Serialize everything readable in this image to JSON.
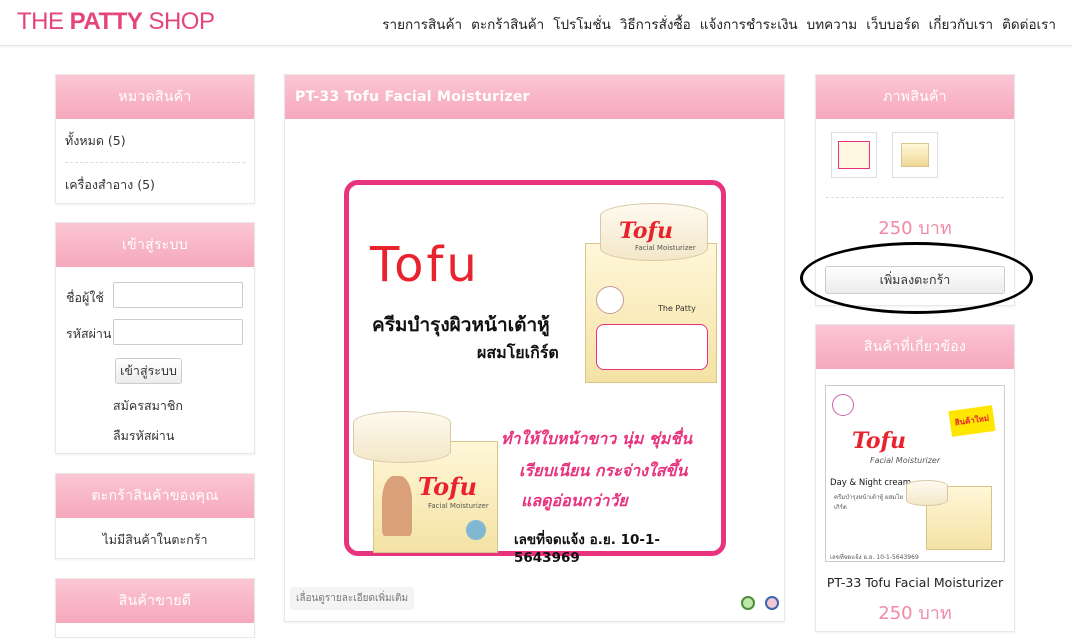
{
  "logo": {
    "part1": "THE ",
    "part2": "PATTY",
    "part3": " SHOP"
  },
  "nav": [
    "รายการสินค้า",
    "ตะกร้าสินค้า",
    "โปรโมชั่น",
    "วิธีการสั่งซื้อ",
    "แจ้งการชำระเงิน",
    "บทความ",
    "เว็บบอร์ด",
    "เกี่ยวกับเรา",
    "ติดต่อเรา"
  ],
  "categories": {
    "title": "หมวดสินค้า",
    "items": [
      "ทั้งหมด (5)",
      "เครื่องสำอาง (5)"
    ]
  },
  "login": {
    "title": "เข้าสู่ระบบ",
    "username_label": "ชื่อผู้ใช้",
    "password_label": "รหัสผ่าน",
    "submit": "เข้าสู่ระบบ",
    "register": "สมัครสมาชิก",
    "forgot": "ลืมรหัสผ่าน"
  },
  "cart": {
    "title": "ตะกร้าสินค้าของคุณ",
    "empty": "ไม่มีสินค้าในตะกร้า"
  },
  "bestsellers": {
    "title": "สินค้าขายดี"
  },
  "product": {
    "title": "PT-33 Tofu Facial Moisturizer",
    "scroll_hint": "เลื่อนดูรายละเอียดเพิ่มเติม",
    "image": {
      "brand": "Tofu",
      "line1": "ครีมบำรุงผิวหน้าเต้าหู้",
      "line2": "ผสมโยเกิร์ต",
      "benefit1": "ทำให้ใบหน้าขาว นุ่ม ชุ่มชื่น",
      "benefit2": "เรียบเนียน กระจ่างใสขึ้น",
      "benefit3": "แลดูอ่อนกว่าวัย",
      "registration": "เลขที่จดแจ้ง อ.ย. 10-1-5643969",
      "box_brand": "Tofu",
      "box_sub": "Facial Moisturizer",
      "the_patty": "The Patty"
    }
  },
  "gallery": {
    "title": "ภาพสินค้า",
    "price": "250 บาท",
    "add_to_cart": "เพิ่มลงตะกร้า"
  },
  "related": {
    "title": "สินค้าที่เกี่ยวข้อง",
    "name": "PT-33 Tofu Facial Moisturizer",
    "price": "250 บาท",
    "image": {
      "badge": "สินค้าใหม่",
      "brand": "Tofu",
      "sub": "Facial Moisturizer",
      "daynight": "Day & Night cream",
      "thai": "ครีมบำรุงหน้าเต้าหู้ ผสมโยเกิร์ต",
      "reg": "เลขที่จดแจ้ง อ.ย. 10-1-5643969"
    }
  },
  "colors": {
    "accent": "#e6457c",
    "panel_header": "#f6a8bd",
    "price": "#f08aa6",
    "frame": "#e8337e"
  }
}
